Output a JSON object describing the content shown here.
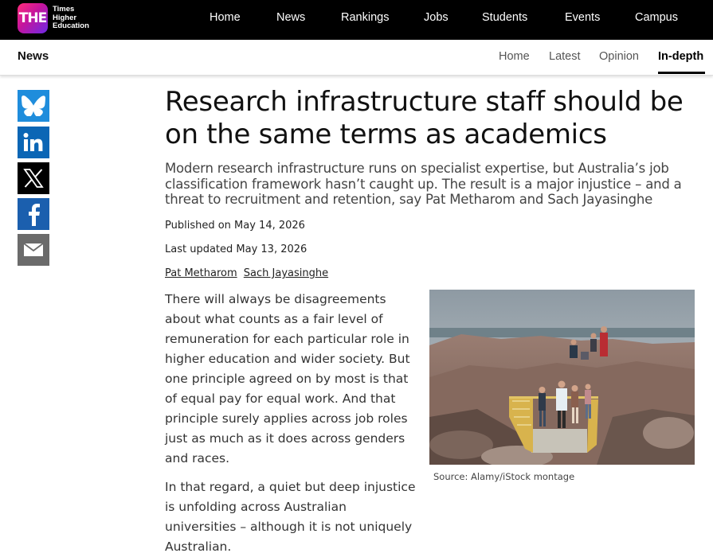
{
  "brand": {
    "logo_mark": "THE",
    "logo_lines": [
      "Times",
      "Higher",
      "Education"
    ]
  },
  "top_nav": [
    "Home",
    "News",
    "Rankings",
    "Jobs",
    "Students",
    "Events",
    "Campus"
  ],
  "sub_nav": {
    "section": "News",
    "items": [
      "Home",
      "Latest",
      "Opinion",
      "In-depth"
    ],
    "active": "In-depth"
  },
  "share_icons": [
    "bluesky-icon",
    "linkedin-icon",
    "x-icon",
    "facebook-icon",
    "email-icon"
  ],
  "article": {
    "headline": "Research infrastructure staff should be on the same terms as academics",
    "standfirst": "Modern research infrastructure runs on specialist expertise, but Australia’s job classification framework hasn’t caught up. The result is a major injustice – and a threat to recruitment and retention, say Pat Metharom and Sach Jayasinghe",
    "published": "Published on May 14, 2026",
    "updated": "Last updated May 13, 2026",
    "authors": [
      "Pat Metharom",
      "Sach Jayasinghe"
    ],
    "paragraphs": [
      "There will always be disagreements about what counts as a fair level of remuneration for each particular role in higher education and wider society. But one principle agreed on by most is that of equal pay for equal work. And that principle surely applies across job roles just as much as it does across genders and races.",
      "In that regard, a quiet but deep injustice is unfolding across Australian universities – although it is not uniquely Australian."
    ],
    "image_caption": "Source: Alamy/iStock montage"
  },
  "colors": {
    "topbar": "#000000",
    "bluesky": "#1f8ddc",
    "linkedin": "#0b66b5",
    "facebook": "#1b5fae",
    "email": "#6b6b6b"
  }
}
